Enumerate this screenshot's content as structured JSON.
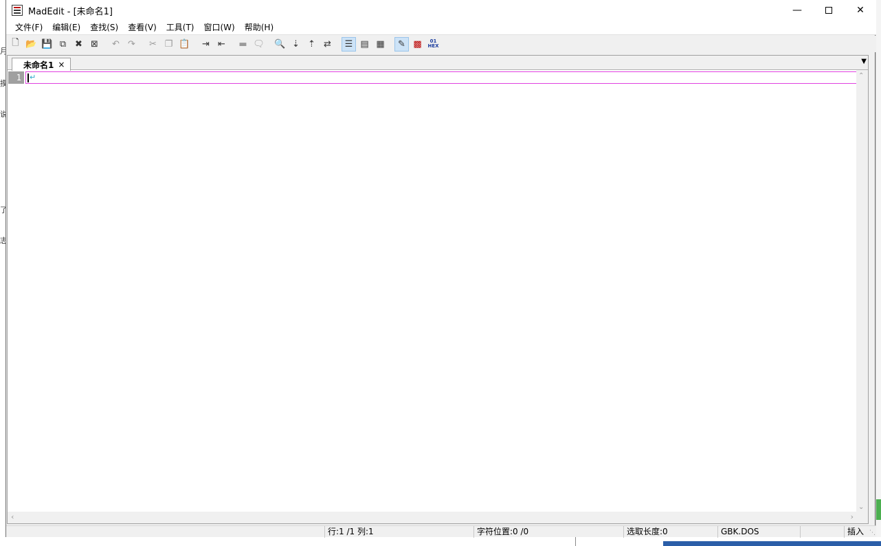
{
  "window": {
    "title": "MadEdit - [未命名1]"
  },
  "menu": {
    "items": [
      "文件(F)",
      "编辑(E)",
      "查找(S)",
      "查看(V)",
      "工具(T)",
      "窗口(W)",
      "帮助(H)"
    ]
  },
  "toolbar": {
    "buttons": [
      {
        "icon": "new-file-icon"
      },
      {
        "icon": "open-file-icon"
      },
      {
        "icon": "save-icon"
      },
      {
        "icon": "save-all-icon"
      },
      {
        "icon": "close-icon"
      },
      {
        "icon": "close-all-icon"
      },
      {
        "icon": "undo-icon"
      },
      {
        "icon": "redo-icon"
      },
      {
        "icon": "cut-icon"
      },
      {
        "icon": "copy-icon"
      },
      {
        "icon": "paste-icon"
      },
      {
        "icon": "indent-icon"
      },
      {
        "icon": "outdent-icon"
      },
      {
        "icon": "comment-icon"
      },
      {
        "icon": "uncomment-icon"
      },
      {
        "icon": "find-icon"
      },
      {
        "icon": "find-next-icon"
      },
      {
        "icon": "find-previous-icon"
      },
      {
        "icon": "replace-icon"
      },
      {
        "icon": "no-wrap-icon",
        "active": true
      },
      {
        "icon": "wrap-by-window-icon"
      },
      {
        "icon": "wrap-by-column-icon"
      },
      {
        "icon": "text-mode-icon",
        "active": true
      },
      {
        "icon": "column-mode-icon"
      },
      {
        "icon": "hex-mode-icon"
      }
    ]
  },
  "tabs": [
    {
      "label": "未命名1",
      "close": "×"
    }
  ],
  "editor": {
    "line_numbers": [
      "1"
    ],
    "eol_marker": "↵"
  },
  "status": {
    "position": "行:1 /1 列:1",
    "char_pos": "字符位置:0 /0",
    "sel_len": "选取长度:0",
    "encoding": "GBK.DOS",
    "mode": "插入"
  },
  "background": {
    "left_glyphs": [
      "月",
      "摸",
      "说",
      "了",
      "志"
    ]
  },
  "colors": {
    "current_line_border": "#e040e0",
    "gutter_bg": "#a0a0a0",
    "eol_marker": "#2aa9c9"
  }
}
